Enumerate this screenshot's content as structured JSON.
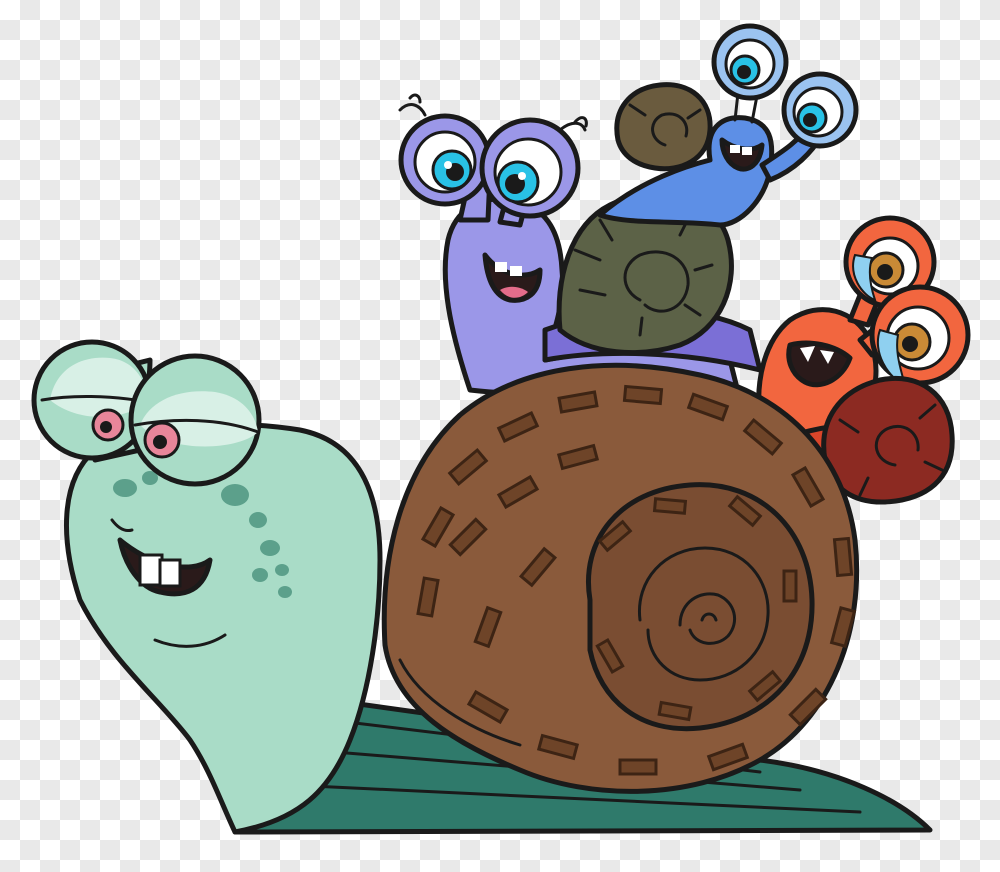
{
  "image": {
    "kind": "cartoon-illustration",
    "background": "transparent-checkerboard",
    "characters": [
      {
        "name": "green-snail",
        "body_color": "#9fd4be",
        "shell_color": "#8a5a3b",
        "expression": "smug-grin",
        "eye_color": "#e8869a"
      },
      {
        "name": "purple-snail",
        "body_color": "#9b97e8",
        "shell_color": "#5c6247",
        "expression": "laughing",
        "eye_color": "#29c2e6"
      },
      {
        "name": "blue-snail",
        "body_color": "#5d8fe6",
        "shell_color": "#6a5b3e",
        "expression": "laughing",
        "eye_color": "#29c2e6"
      },
      {
        "name": "orange-snail",
        "body_color": "#f2663f",
        "shell_color": "#8c2a22",
        "expression": "crying-laughing",
        "eye_color": "#c98a36"
      }
    ]
  }
}
